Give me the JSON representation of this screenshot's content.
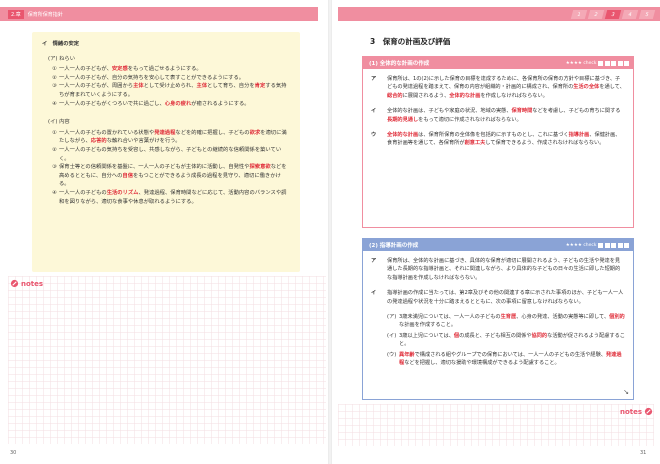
{
  "left_page": {
    "chapter_tag": "2.章",
    "chapter_title": "保育所保育指針",
    "page_number": "30",
    "notes_label": "notes",
    "box": {
      "heading": "イ　情緒の安定",
      "aims_heading": "(ア) ねらい",
      "aims": [
        {
          "num": "①",
          "pre": "一人一人の子どもが、",
          "red": "安定感",
          "post": "をもって過ごせるようにする。"
        },
        {
          "num": "②",
          "pre": "一人一人の子どもが、自分の気持ちを安心して表すことができるようにする。",
          "red": "",
          "post": ""
        },
        {
          "num": "③",
          "pre": "一人一人の子どもが、周囲から",
          "red": "主体",
          "post": "として受け止められ、",
          "red2": "主体",
          "post2": "として育ち、自分を",
          "red3": "肯定",
          "post3": "する気持ちが育まれていくようにする。"
        },
        {
          "num": "④",
          "pre": "一人一人の子どもがくつろいで共に過ごし、",
          "red": "心身の疲れ",
          "post": "が癒されるようにする。"
        }
      ],
      "content_heading": "(イ) 内容",
      "contents": [
        {
          "num": "①",
          "pre": "一人一人の子どもの置かれている状態や",
          "red": "発達過程",
          "post": "などを的確に把握し、子どもの",
          "red2": "欲求",
          "post2": "を適切に満たしながら、",
          "red3": "応答的",
          "post3": "な触れ合いや言葉がけを行う。"
        },
        {
          "num": "②",
          "pre": "一人一人の子どもの気持ちを受容し、共感しながら、子どもとの継続的な信頼関係を築いていく。",
          "red": "",
          "post": ""
        },
        {
          "num": "③",
          "pre": "保育士等との信頼関係を基盤に、一人一人の子どもが主体的に活動し、自発性や",
          "red": "探索意欲",
          "post": "などを高めるとともに、自分への",
          "red2": "自信",
          "post2": "をもつことができるよう成長の過程を見守り、適切に働きかける。"
        },
        {
          "num": "④",
          "pre": "一人一人の子どもの",
          "red": "生活のリズム",
          "post": "、発達過程、保育時間などに応じて、活動内容のバランスや調和を図りながら、適切な食事や休息が取れるようにする。"
        }
      ]
    }
  },
  "right_page": {
    "page_number": "31",
    "notes_label": "notes",
    "tabs": [
      "1",
      "2",
      "3",
      "4",
      "5"
    ],
    "active_tab": "3",
    "section_title": "3　保育の計画及び評価",
    "box1": {
      "title": "(1) 全体的な計画の作成",
      "check_label": "★★★★ check",
      "paras": [
        {
          "mk": "ア",
          "pre": "保育所は、1の(2)に示した保育の目標を達成するために、各保育所の保育の方針や目標に基づき、子どもの発達過程を踏まえて、保育の内容が組織的・計画的に構成され、保育所の",
          "red": "生活の全体",
          "post": "を通して、",
          "red2": "総合的",
          "post2": "に展開されるよう、",
          "red3": "全体的な計画",
          "post3": "を作成しなければならない。"
        },
        {
          "mk": "イ",
          "pre": "全体的な計画は、子どもや家庭の状況、地域の実態、",
          "red": "保育時間",
          "post": "などを考慮し、子どもの育ちに関する",
          "red2": "長期的見通し",
          "post2": "をもって適切に作成されなければならない。",
          "red3": "",
          "post3": ""
        },
        {
          "mk": "ウ",
          "pre": "",
          "red": "全体的な計画",
          "post": "は、保育所保育の全体像を包括的に示すものとし、これに基づく",
          "red2": "指導計画",
          "post2": "、保健計画、食育計画等を通じて、各保育所が",
          "red3": "創意工夫",
          "post3": "して保育できるよう、作成されなければならない。"
        }
      ]
    },
    "box2": {
      "title": "(2) 指導計画の作成",
      "check_label": "★★★★ check",
      "paras": [
        {
          "mk": "ア",
          "text": "保育所は、全体的な計画に基づき、具体的な保育が適切に展開されるよう、子どもの生活や発達を見通した長期的な指導計画と、それに関連しながら、より具体的な子どもの日々の生活に即した短期的な指導計画を作成しなければならない。"
        },
        {
          "mk": "イ",
          "text": "指導計画の作成に当たっては、第2章及びその他の関連する章に示された事項のほか、子ども一人一人の発達過程や状況を十分に踏まえるとともに、次の事項に留意しなければならない。"
        }
      ],
      "subparas": [
        {
          "mk": "(ア)",
          "pre": "3歳未満児については、一人一人の子どもの",
          "red": "生育歴",
          "post": "、心身の発達、活動の実態等に即して、",
          "red2": "個別的",
          "post2": "な計画を作成すること。"
        },
        {
          "mk": "(イ)",
          "pre": "3歳以上児については、",
          "red": "個",
          "post": "の成長と、子ども相互の関係や",
          "red2": "協同的",
          "post2": "な活動が促されるよう配慮すること。"
        },
        {
          "mk": "(ウ)",
          "pre": "",
          "red": "異年齢",
          "post": "で構成される組やグループでの保育においては、一人一人の子どもの生活や経験、",
          "red2": "発達過程",
          "post2": "などを把握し、適切な援助や環境構成ができるよう配慮すること。"
        }
      ]
    }
  }
}
